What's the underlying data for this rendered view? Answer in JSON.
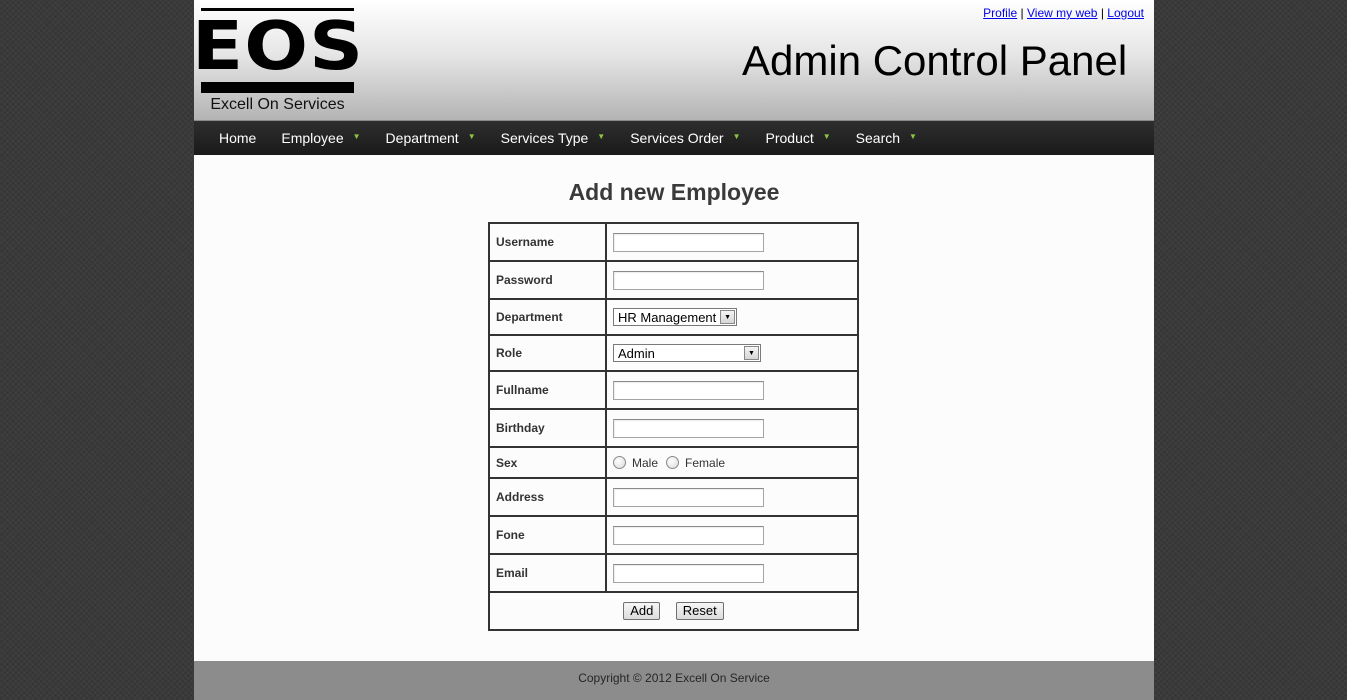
{
  "header": {
    "logo_letters": "EOS",
    "logo_subtitle": "Excell On Services",
    "panel_title": "Admin Control Panel",
    "links": {
      "profile": "Profile",
      "view_web": "View my web",
      "logout": "Logout",
      "separator": "|"
    }
  },
  "nav": {
    "items": [
      {
        "label": "Home",
        "has_dropdown": false
      },
      {
        "label": "Employee",
        "has_dropdown": true
      },
      {
        "label": "Department",
        "has_dropdown": true
      },
      {
        "label": "Services Type",
        "has_dropdown": true
      },
      {
        "label": "Services Order",
        "has_dropdown": true
      },
      {
        "label": "Product",
        "has_dropdown": true
      },
      {
        "label": "Search",
        "has_dropdown": true
      }
    ],
    "dropdown_icon": "chevron-down-icon",
    "dropdown_glyph": "▼"
  },
  "form": {
    "title": "Add new Employee",
    "fields": {
      "username": {
        "label": "Username",
        "value": ""
      },
      "password": {
        "label": "Password",
        "value": ""
      },
      "department": {
        "label": "Department",
        "value": "HR Management"
      },
      "role": {
        "label": "Role",
        "value": "Admin"
      },
      "fullname": {
        "label": "Fullname",
        "value": ""
      },
      "birthday": {
        "label": "Birthday",
        "value": ""
      },
      "sex": {
        "label": "Sex",
        "options": [
          "Male",
          "Female"
        ]
      },
      "address": {
        "label": "Address",
        "value": ""
      },
      "fone": {
        "label": "Fone",
        "value": ""
      },
      "email": {
        "label": "Email",
        "value": ""
      }
    },
    "buttons": {
      "add": "Add",
      "reset": "Reset"
    }
  },
  "footer": {
    "copyright": "Copyright © 2012 Excell On Service"
  },
  "colors": {
    "nav_bg": "#1f1f1f",
    "nav_arrow": "#8cc63f",
    "link": "#0000ee",
    "footer_bg": "#8c8c8c"
  }
}
